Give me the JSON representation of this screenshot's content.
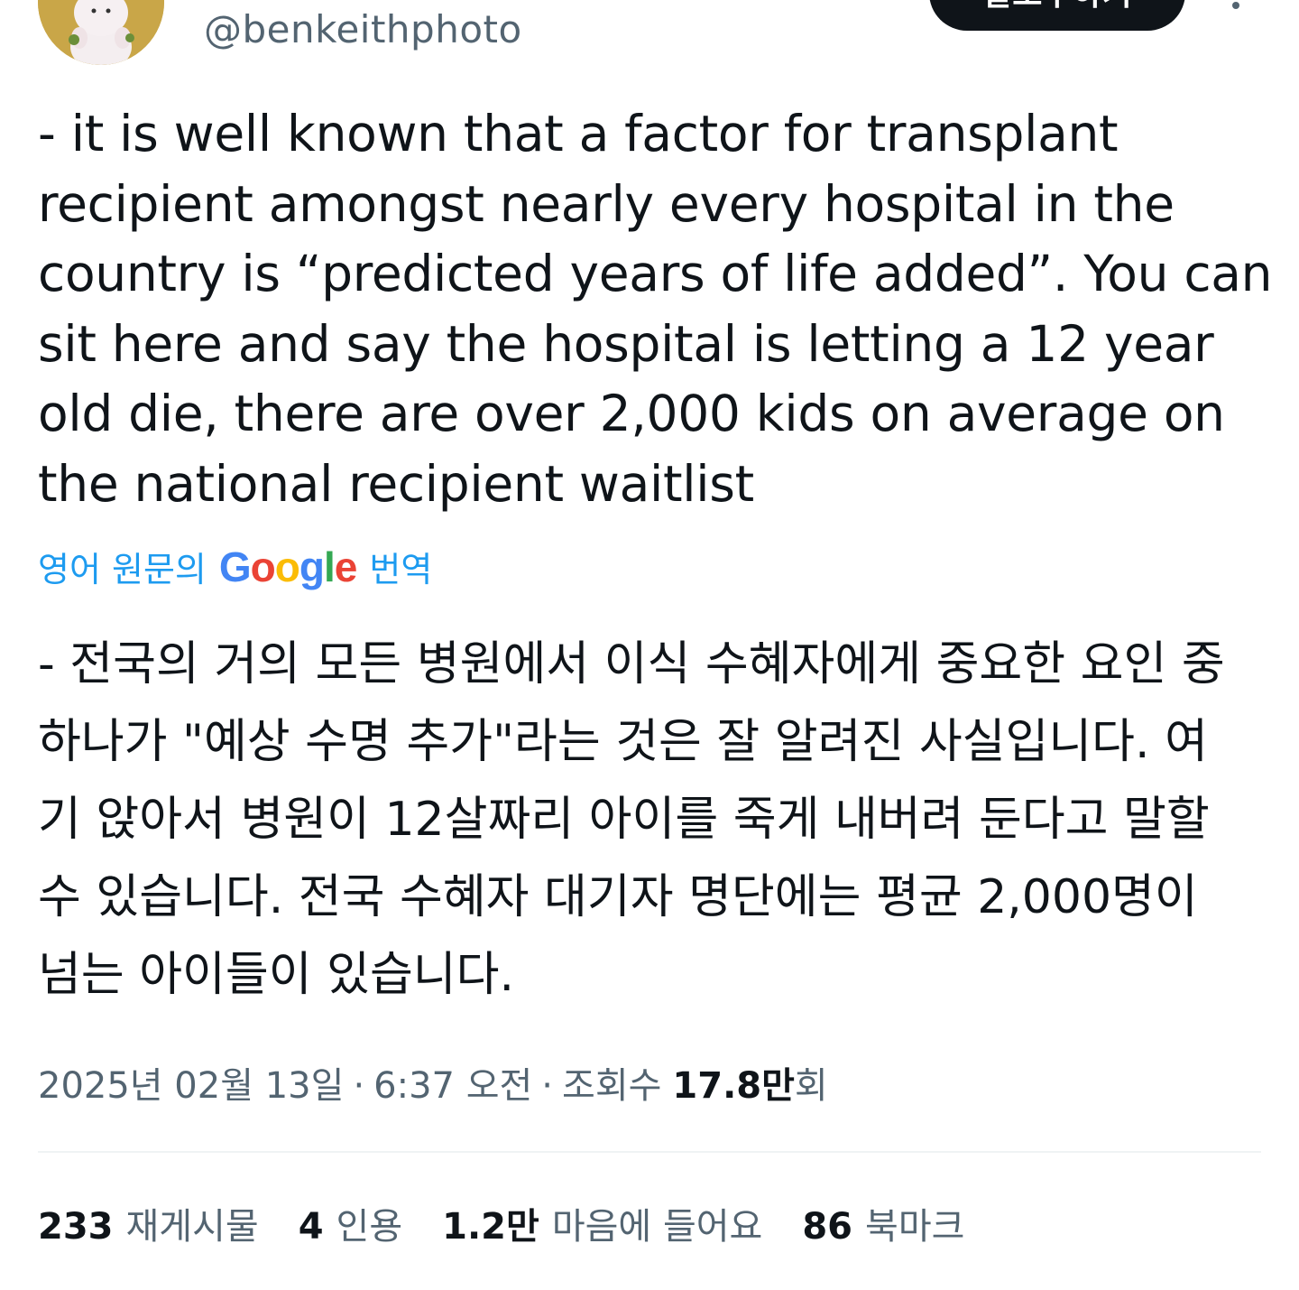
{
  "header": {
    "handle": "@benkeithphoto",
    "follow_label": "팔로우하기"
  },
  "tweet": {
    "text": "- it is well known that a factor for transplant recipient amongst nearly every hospital in the country is “predicted years of life added”. You can sit here and say the hospital is letting a 12 year old die, there are over 2,000 kids on average on the national recipient waitlist",
    "translate_prefix": "영어 원문의",
    "translate_google": [
      "G",
      "o",
      "o",
      "g",
      "l",
      "e"
    ],
    "translate_suffix": "번역",
    "translated_text": "- 전국의 거의 모든 병원에서 이식 수혜자에게 중요한 요인 중 하나가 \"예상 수명 추가\"라는 것은 잘 알려진 사실입니다. 여기 앉아서 병원이 12살짜리 아이를 죽게 내버려 둔다고 말할 수 있습니다. 전국 수혜자 대기자 명단에는 평균 2,000명이 넘는 아이들이 있습니다."
  },
  "meta": {
    "date": "2025년 02월 13일",
    "separator": "·",
    "time": "6:37 오전",
    "views_label": "조회수",
    "views_count": "17.8만",
    "views_suffix": "회"
  },
  "stats": [
    {
      "count": "233",
      "label": "재게시물"
    },
    {
      "count": "4",
      "label": "인용"
    },
    {
      "count": "1.2만",
      "label": "마음에 들어요"
    },
    {
      "count": "86",
      "label": "북마크"
    }
  ],
  "colors": {
    "text": "#0f1419",
    "secondary": "#536471",
    "link": "#1d9bf0",
    "divider": "#eff3f4",
    "google": [
      "#4285f4",
      "#ea4335",
      "#fbbc05",
      "#4285f4",
      "#34a853",
      "#ea4335"
    ]
  },
  "icons": {
    "avatar": "cartoon-avatar-icon",
    "more": "more-dots-icon"
  }
}
